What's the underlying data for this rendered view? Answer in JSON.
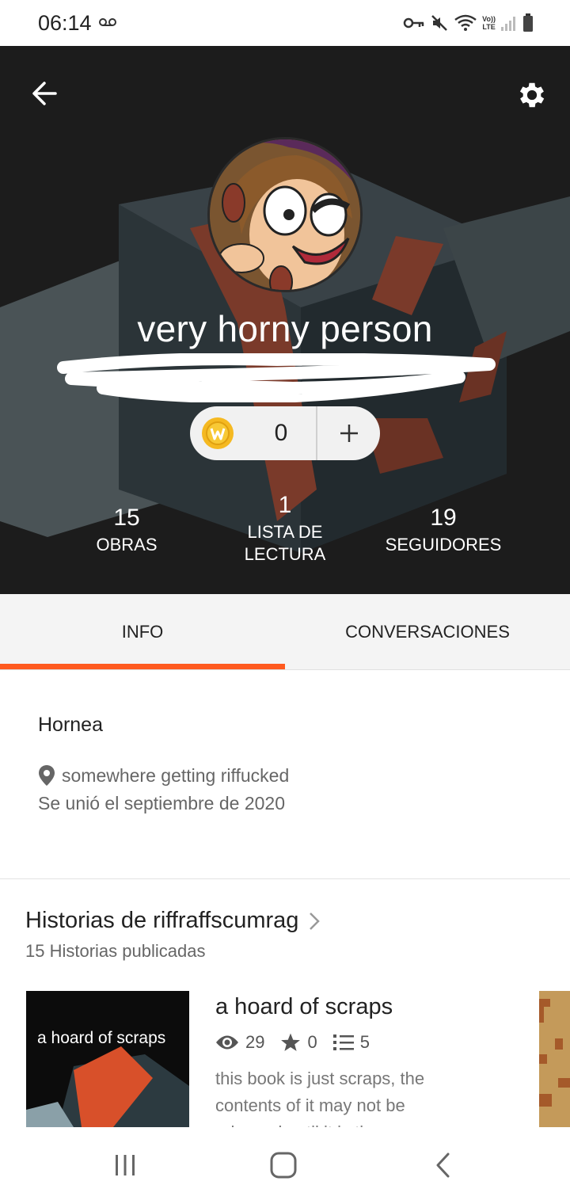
{
  "status_bar": {
    "time": "06:14",
    "lte_label": "LTE",
    "volte_label": "Vo))"
  },
  "header": {
    "username": "very horny person",
    "coins": {
      "count": "0"
    },
    "stats": [
      {
        "value": "15",
        "label": "OBRAS"
      },
      {
        "value": "1",
        "label_line1": "LISTA DE",
        "label_line2": "LECTURA"
      },
      {
        "value": "19",
        "label": "SEGUIDORES"
      }
    ]
  },
  "tabs": {
    "info": "INFO",
    "conversations": "CONVERSACIONES",
    "active": "INFO"
  },
  "info": {
    "bio": "Hornea",
    "location": "somewhere getting riffucked",
    "joined": "Se unió el septiembre de 2020"
  },
  "stories": {
    "title": "Historias de riffraffscumrag",
    "subtitle": "15 Historias publicadas",
    "items": [
      {
        "cover_text": "a hoard of scraps",
        "title": "a hoard of scraps",
        "reads": "29",
        "votes": "0",
        "parts": "5",
        "description": "this book is just scraps, the contents  of it may not be released until it is time"
      }
    ]
  },
  "colors": {
    "accent": "#ff5a1f",
    "hero_bg": "#1a1a1a",
    "coin": "#f5b921"
  },
  "icons": [
    "back-arrow-icon",
    "gear-icon",
    "coin-icon",
    "plus-icon",
    "location-pin-icon",
    "chevron-right-icon",
    "eye-icon",
    "star-icon",
    "list-icon",
    "recent-apps-icon",
    "home-icon",
    "nav-back-icon"
  ]
}
